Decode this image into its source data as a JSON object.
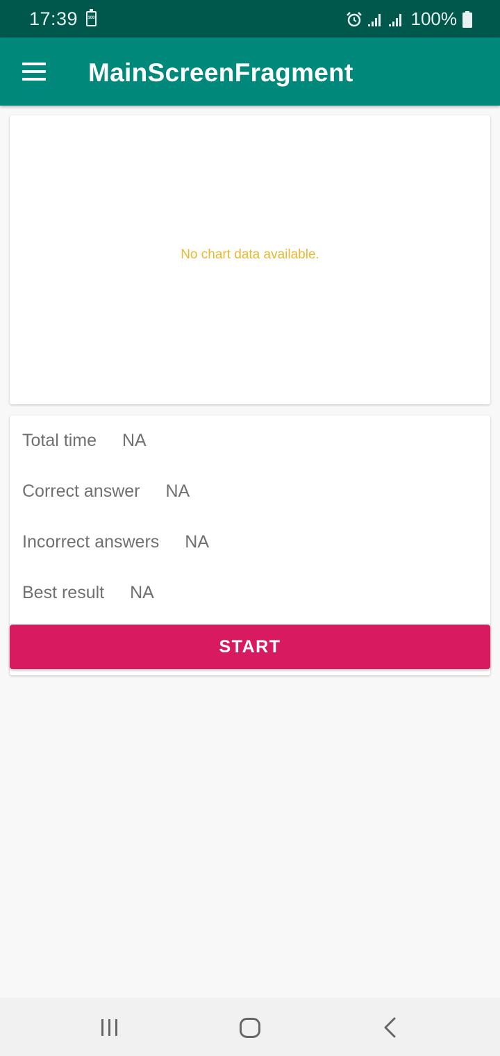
{
  "status_bar": {
    "time": "17:39",
    "battery_small_label": "100",
    "battery_percent": "100%",
    "icons": [
      "battery-saver-icon",
      "alarm-icon",
      "signal-icon",
      "signal-icon",
      "battery-icon"
    ]
  },
  "app_bar": {
    "title": "MainScreenFragment",
    "menu_icon": "menu-icon"
  },
  "chart": {
    "empty_text": "No chart data available."
  },
  "stats": [
    {
      "label": "Total time",
      "value": "NA"
    },
    {
      "label": "Correct answer",
      "value": "NA"
    },
    {
      "label": "Incorrect answers",
      "value": "NA"
    },
    {
      "label": "Best result",
      "value": "NA"
    }
  ],
  "start_button": {
    "label": "START"
  },
  "nav_bar": {
    "icons": [
      "recents-icon",
      "home-icon",
      "back-icon"
    ]
  },
  "colors": {
    "status_bar": "#00574b",
    "app_bar": "#00897b",
    "accent": "#d81b60",
    "empty_chart_text": "#e8b830",
    "background": "#f8f8f8"
  }
}
